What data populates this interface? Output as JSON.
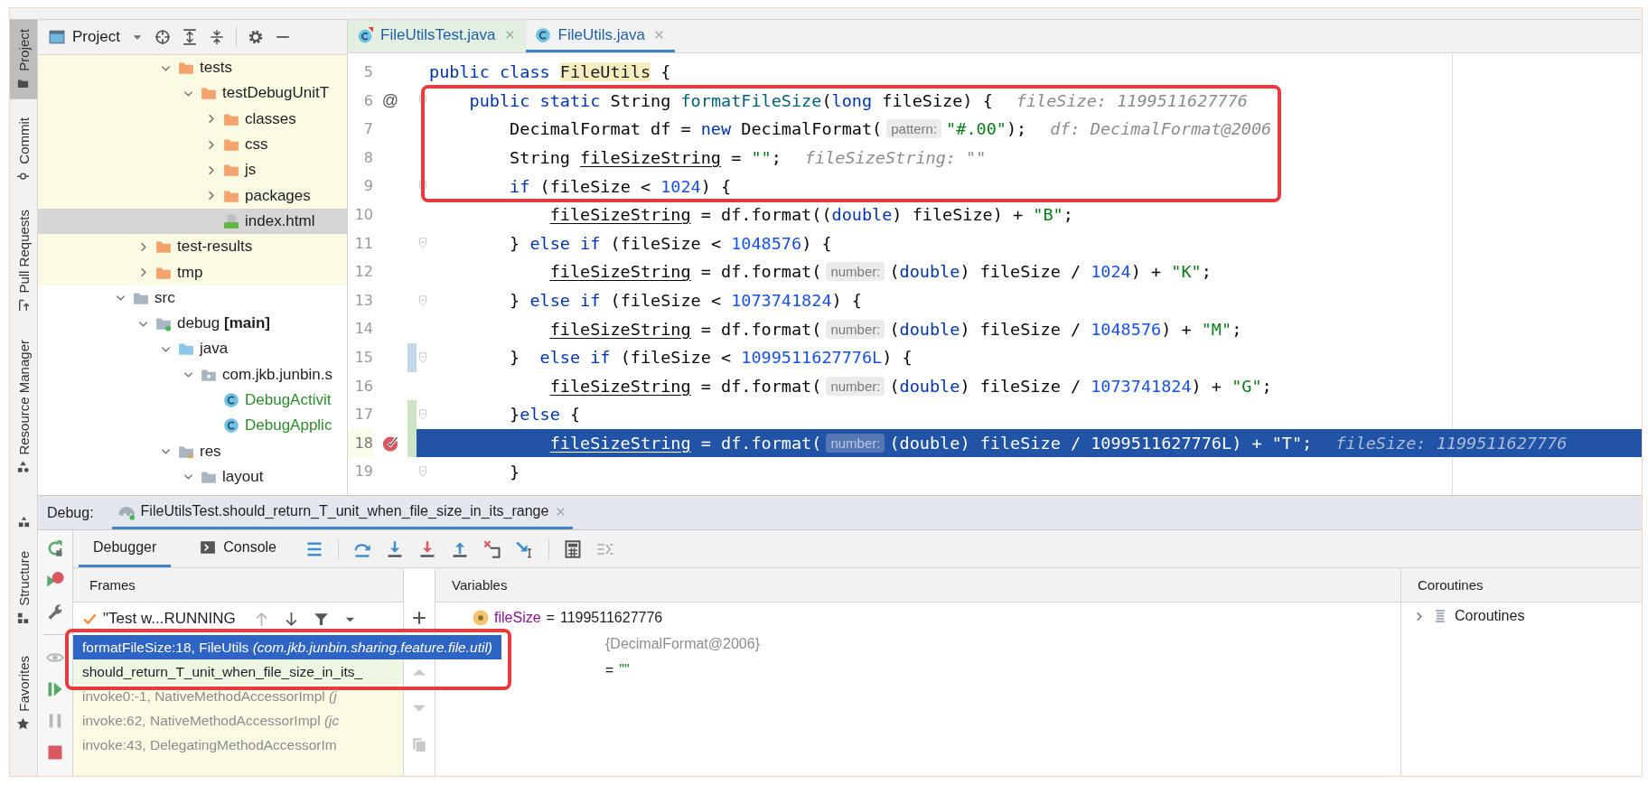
{
  "tool_strip": {
    "top": [
      {
        "label": "Project",
        "kind": "project",
        "selected": true
      },
      {
        "label": "Commit",
        "kind": "commit",
        "selected": false
      },
      {
        "label": "Pull Requests",
        "kind": "pull",
        "selected": false
      },
      {
        "label": "Resource Manager",
        "kind": "resource",
        "selected": false
      }
    ],
    "bottom": [
      {
        "label": "Structure",
        "kind": "structure",
        "selected": false
      },
      {
        "label": "Favorites",
        "kind": "favorites",
        "selected": false
      }
    ]
  },
  "project_panel": {
    "title": "Project",
    "tree": [
      {
        "children": [
          {
            "children": [
              {
                "label": "tests",
                "kind": "folder",
                "expanded": true,
                "excluded": true,
                "added": false,
                "selected": false,
                "children": [
                  {
                    "label": "testDebugUnitT",
                    "kind": "folder",
                    "expanded": true,
                    "excluded": true,
                    "added": false,
                    "selected": false,
                    "children": [
                      {
                        "label": "classes",
                        "kind": "folder",
                        "expanded": false,
                        "excluded": true,
                        "added": false,
                        "selected": false
                      },
                      {
                        "label": "css",
                        "kind": "folder",
                        "expanded": false,
                        "excluded": true,
                        "added": false,
                        "selected": false
                      },
                      {
                        "label": "js",
                        "kind": "folder",
                        "expanded": false,
                        "excluded": true,
                        "added": false,
                        "selected": false
                      },
                      {
                        "label": "packages",
                        "kind": "folder",
                        "expanded": false,
                        "excluded": true,
                        "added": false,
                        "selected": false
                      },
                      {
                        "label": "index.html",
                        "kind": "html",
                        "excluded": true,
                        "added": false,
                        "selected": true
                      }
                    ]
                  }
                ]
              }
            ]
          },
          {
            "label": "test-results",
            "kind": "folder",
            "expanded": false,
            "excluded": true,
            "added": false,
            "selected": false
          },
          {
            "label": "tmp",
            "kind": "folder",
            "expanded": false,
            "excluded": true,
            "added": false,
            "selected": false
          }
        ]
      },
      {
        "label": "src",
        "kind": "folder",
        "expanded": true,
        "excluded": false,
        "added": false,
        "selected": false,
        "children": [
          {
            "label": "debug **[main]**",
            "kind": "module",
            "expanded": true,
            "excluded": false,
            "added": false,
            "selected": false,
            "children": [
              {
                "label": "java",
                "kind": "sourceroot",
                "expanded": true,
                "excluded": false,
                "added": false,
                "selected": false,
                "children": [
                  {
                    "label": "com.jkb.junbin.s",
                    "kind": "package",
                    "expanded": true,
                    "excluded": false,
                    "added": false,
                    "selected": false,
                    "children": [
                      {
                        "label": "DebugActivit",
                        "kind": "class",
                        "excluded": false,
                        "added": true,
                        "selected": false
                      },
                      {
                        "label": "DebugApplic",
                        "kind": "class",
                        "excluded": false,
                        "added": true,
                        "selected": false
                      }
                    ]
                  }
                ]
              },
              {
                "label": "res",
                "kind": "resfolder",
                "expanded": true,
                "excluded": false,
                "added": false,
                "selected": false,
                "children": [
                  {
                    "label": "layout",
                    "kind": "folder",
                    "expanded": true,
                    "excluded": false,
                    "added": false,
                    "selected": false
                  }
                ]
              }
            ]
          }
        ]
      }
    ]
  },
  "editor": {
    "tabs": [
      {
        "label": "FileUtilsTest.java",
        "kind": "testclass",
        "selected": false
      },
      {
        "label": "FileUtils.java",
        "kind": "class",
        "selected": true
      }
    ],
    "lines": [
      {
        "number": "5",
        "fold": false,
        "annotated": false,
        "highlighted": false,
        "breakpoint": false,
        "segments": [
          {
            "kind": "keyword",
            "text": "public class "
          },
          {
            "kind": "match",
            "text": "FileUtils"
          },
          {
            "kind": "plain",
            "text": " {"
          }
        ]
      },
      {
        "number": "6",
        "gutter_text": "@",
        "fold": true,
        "annotated": true,
        "highlighted": false,
        "breakpoint": false,
        "segments": [
          {
            "kind": "keyword",
            "text": "    public static "
          },
          {
            "kind": "plain",
            "text": "String "
          },
          {
            "kind": "method",
            "text": "formatFileSize"
          },
          {
            "kind": "plain",
            "text": "("
          },
          {
            "kind": "keyword",
            "text": "long"
          },
          {
            "kind": "plain",
            "text": " fileSize) {"
          },
          {
            "kind": "hint",
            "text": "fileSize: 1199511627776"
          }
        ]
      },
      {
        "number": "7",
        "fold": false,
        "annotated": true,
        "highlighted": false,
        "breakpoint": false,
        "segments": [
          {
            "kind": "plain",
            "text": "        DecimalFormat df = "
          },
          {
            "kind": "keyword",
            "text": "new"
          },
          {
            "kind": "plain",
            "text": " DecimalFormat("
          },
          {
            "kind": "param",
            "text": "pattern:"
          },
          {
            "kind": "string",
            "text": "\"#.00\""
          },
          {
            "kind": "plain",
            "text": ");"
          },
          {
            "kind": "hint",
            "text": "df: DecimalFormat@2006"
          }
        ]
      },
      {
        "number": "8",
        "fold": false,
        "annotated": true,
        "highlighted": false,
        "breakpoint": false,
        "segments": [
          {
            "kind": "plain",
            "text": "        String "
          },
          {
            "kind": "var",
            "text": "fileSizeString"
          },
          {
            "kind": "plain",
            "text": " = "
          },
          {
            "kind": "string",
            "text": "\"\""
          },
          {
            "kind": "plain",
            "text": ";"
          },
          {
            "kind": "hint",
            "text": "fileSizeString: \"\""
          }
        ]
      },
      {
        "number": "9",
        "fold": true,
        "annotated": true,
        "highlighted": false,
        "breakpoint": false,
        "segments": [
          {
            "kind": "keyword",
            "text": "        if"
          },
          {
            "kind": "plain",
            "text": " (fileSize < "
          },
          {
            "kind": "number",
            "text": "1024"
          },
          {
            "kind": "plain",
            "text": ") {"
          }
        ]
      },
      {
        "number": "10",
        "fold": false,
        "annotated": false,
        "highlighted": false,
        "breakpoint": false,
        "segments": [
          {
            "kind": "var",
            "text": "            fileSizeString"
          },
          {
            "kind": "plain",
            "text": " = df.format(("
          },
          {
            "kind": "keyword",
            "text": "double"
          },
          {
            "kind": "plain",
            "text": ") fileSize) + "
          },
          {
            "kind": "string",
            "text": "\"B\""
          },
          {
            "kind": "plain",
            "text": ";"
          }
        ]
      },
      {
        "number": "11",
        "fold": true,
        "annotated": false,
        "highlighted": false,
        "breakpoint": false,
        "segments": [
          {
            "kind": "plain",
            "text": "        } "
          },
          {
            "kind": "keyword",
            "text": "else if"
          },
          {
            "kind": "plain",
            "text": " (fileSize < "
          },
          {
            "kind": "number",
            "text": "1048576"
          },
          {
            "kind": "plain",
            "text": ") {"
          }
        ]
      },
      {
        "number": "12",
        "fold": false,
        "annotated": false,
        "highlighted": false,
        "breakpoint": false,
        "segments": [
          {
            "kind": "var",
            "text": "            fileSizeString"
          },
          {
            "kind": "plain",
            "text": " = df.format("
          },
          {
            "kind": "param",
            "text": "number:"
          },
          {
            "kind": "plain",
            "text": "("
          },
          {
            "kind": "keyword",
            "text": "double"
          },
          {
            "kind": "plain",
            "text": ") fileSize / "
          },
          {
            "kind": "number",
            "text": "1024"
          },
          {
            "kind": "plain",
            "text": ") + "
          },
          {
            "kind": "string",
            "text": "\"K\""
          },
          {
            "kind": "plain",
            "text": ";"
          }
        ]
      },
      {
        "number": "13",
        "fold": true,
        "annotated": false,
        "highlighted": false,
        "breakpoint": false,
        "segments": [
          {
            "kind": "plain",
            "text": "        } "
          },
          {
            "kind": "keyword",
            "text": "else if"
          },
          {
            "kind": "plain",
            "text": " (fileSize < "
          },
          {
            "kind": "number",
            "text": "1073741824"
          },
          {
            "kind": "plain",
            "text": ") {"
          }
        ]
      },
      {
        "number": "14",
        "fold": false,
        "annotated": false,
        "highlighted": false,
        "breakpoint": false,
        "segments": [
          {
            "kind": "var",
            "text": "            fileSizeString"
          },
          {
            "kind": "plain",
            "text": " = df.format("
          },
          {
            "kind": "param",
            "text": "number:"
          },
          {
            "kind": "plain",
            "text": "("
          },
          {
            "kind": "keyword",
            "text": "double"
          },
          {
            "kind": "plain",
            "text": ") fileSize / "
          },
          {
            "kind": "number",
            "text": "1048576"
          },
          {
            "kind": "plain",
            "text": ") + "
          },
          {
            "kind": "string",
            "text": "\"M\""
          },
          {
            "kind": "plain",
            "text": ";"
          }
        ]
      },
      {
        "number": "15",
        "fold": true,
        "modified": true,
        "added": false,
        "annotated": false,
        "highlighted": false,
        "breakpoint": false,
        "segments": [
          {
            "kind": "plain",
            "text": "        }  "
          },
          {
            "kind": "keyword",
            "text": "else if"
          },
          {
            "kind": "plain",
            "text": " (fileSize < "
          },
          {
            "kind": "number",
            "text": "1099511627776L"
          },
          {
            "kind": "plain",
            "text": ") {"
          }
        ]
      },
      {
        "number": "16",
        "fold": false,
        "annotated": false,
        "highlighted": false,
        "breakpoint": false,
        "segments": [
          {
            "kind": "var",
            "text": "            fileSizeString"
          },
          {
            "kind": "plain",
            "text": " = df.format("
          },
          {
            "kind": "param",
            "text": "number:"
          },
          {
            "kind": "plain",
            "text": "("
          },
          {
            "kind": "keyword",
            "text": "double"
          },
          {
            "kind": "plain",
            "text": ") fileSize / "
          },
          {
            "kind": "number",
            "text": "1073741824"
          },
          {
            "kind": "plain",
            "text": ") + "
          },
          {
            "kind": "string",
            "text": "\"G\""
          },
          {
            "kind": "plain",
            "text": ";"
          }
        ]
      },
      {
        "number": "17",
        "fold": true,
        "modified": false,
        "added": true,
        "annotated": false,
        "highlighted": false,
        "breakpoint": false,
        "segments": [
          {
            "kind": "plain",
            "text": "        }"
          },
          {
            "kind": "keyword",
            "text": "else"
          },
          {
            "kind": "plain",
            "text": " {"
          }
        ]
      },
      {
        "number": "18",
        "fold": false,
        "modified": false,
        "added": true,
        "annotated": false,
        "highlighted": true,
        "breakpoint": true,
        "segments": [
          {
            "kind": "var",
            "text": "            fileSizeString"
          },
          {
            "kind": "plain",
            "text": " = df.format("
          },
          {
            "kind": "param",
            "text": "number:"
          },
          {
            "kind": "plain",
            "text": "("
          },
          {
            "kind": "keyword",
            "text": "double"
          },
          {
            "kind": "plain",
            "text": ") fileSize / "
          },
          {
            "kind": "number",
            "text": "1099511627776L"
          },
          {
            "kind": "plain",
            "text": ") + "
          },
          {
            "kind": "string",
            "text": "\"T\""
          },
          {
            "kind": "plain",
            "text": ";"
          },
          {
            "kind": "hint",
            "text": "fileSize: 1199511627776"
          }
        ]
      },
      {
        "number": "19",
        "fold": true,
        "annotated": false,
        "highlighted": false,
        "breakpoint": false,
        "segments": [
          {
            "kind": "plain",
            "text": "        }"
          }
        ]
      }
    ]
  },
  "debug": {
    "title": "Debug:",
    "session_tab": {
      "label": "FileUtilsTest.should_return_T_unit_when_file_size_in_its_range",
      "selected": true
    },
    "side_icons": [
      {
        "kind": "rerun",
        "disabled": false
      },
      {
        "kind": "rerunfailed",
        "disabled": false
      },
      {
        "kind": "settings",
        "disabled": false
      },
      {
        "kind": "separator"
      },
      {
        "kind": "breakpoints",
        "disabled": true
      },
      {
        "kind": "resume",
        "disabled": false
      },
      {
        "kind": "pause",
        "disabled": true
      },
      {
        "kind": "stop",
        "disabled": false
      }
    ],
    "tabs": [
      {
        "label": "Debugger",
        "kind": "plain",
        "selected": true
      },
      {
        "label": "Console",
        "kind": "console",
        "selected": false
      }
    ],
    "toolbar": [
      {
        "kind": "layout",
        "disabled": false
      },
      {
        "kind": "separator"
      },
      {
        "kind": "stepover",
        "disabled": false
      },
      {
        "kind": "stepinto",
        "disabled": false
      },
      {
        "kind": "forcestepinto",
        "disabled": false
      },
      {
        "kind": "stepout",
        "disabled": false
      },
      {
        "kind": "dropframe",
        "disabled": false
      },
      {
        "kind": "runtocursor",
        "disabled": false
      },
      {
        "kind": "separator"
      },
      {
        "kind": "evaluate",
        "disabled": false
      },
      {
        "kind": "trace",
        "disabled": true
      }
    ],
    "frames": {
      "title": "Frames",
      "thread": "\"Test w...RUNNING",
      "items": [
        {
          "method": "formatFileSize:18, FileUtils",
          "package": "(com.jkb.junbin.sharing.feature.file.util)",
          "kind": "user",
          "selected": true,
          "annotated": true
        },
        {
          "method": "should_return_T_unit_when_file_size_in_its_",
          "kind": "test",
          "selected": false,
          "annotated": true
        },
        {
          "method": "invoke0:-1, NativeMethodAccessorImpl",
          "package": "(j",
          "kind": "library",
          "selected": false
        },
        {
          "method": "invoke:62, NativeMethodAccessorImpl",
          "package": "(jc",
          "kind": "library",
          "selected": false
        },
        {
          "method": "invoke:43, DelegatingMethodAccessorIm",
          "kind": "library",
          "selected": false
        }
      ]
    },
    "variables": {
      "title": "Variables",
      "items": [
        {
          "name": "fileSize",
          "sign": "=",
          "value": "1199511627776",
          "kind": "primitive"
        },
        {
          "value": "{DecimalFormat@2006}",
          "kind": "object"
        },
        {
          "sign": "=",
          "value": "\"\"",
          "kind": "string"
        }
      ]
    },
    "coroutines": {
      "title": "Coroutines",
      "items": [
        {
          "label": "Coroutines",
          "expanded": false
        }
      ]
    }
  }
}
